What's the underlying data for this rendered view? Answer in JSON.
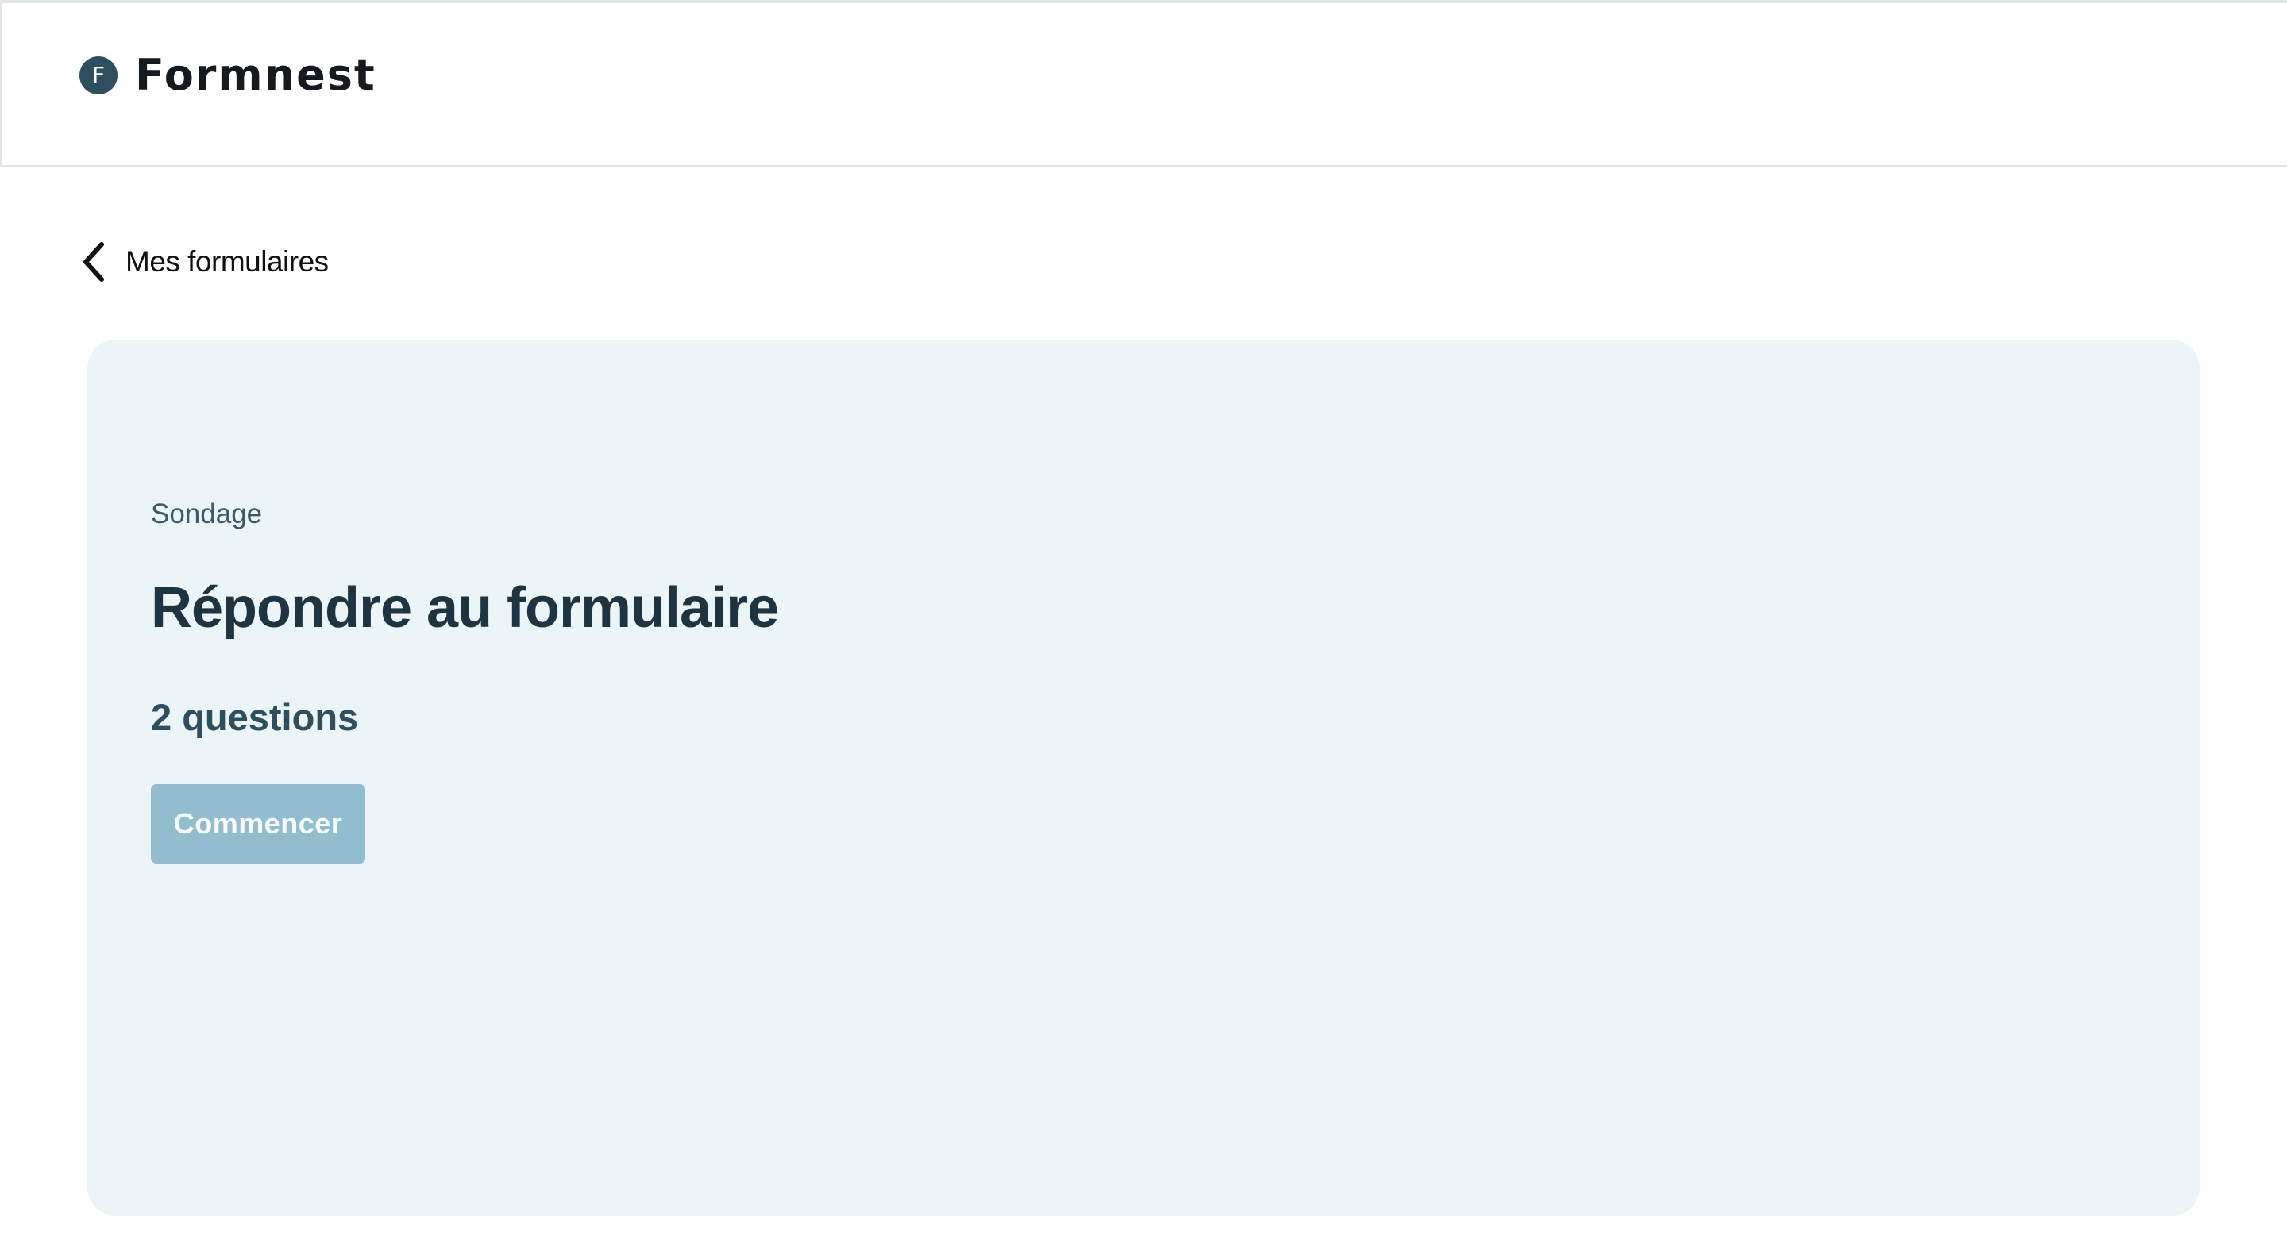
{
  "header": {
    "logo_letter": "F",
    "app_name": "Formnest"
  },
  "nav": {
    "back_label": "Mes formulaires",
    "back_icon": "chevron-left-icon"
  },
  "form_card": {
    "type_label": "Sondage",
    "title": "Répondre au formulaire",
    "question_count": "2 questions",
    "start_button_label": "Commencer"
  },
  "colors": {
    "brand": "#2f4e5e",
    "card_background": "#ebf4f7",
    "button_background": "#91bdce",
    "title_text": "#1e3440"
  }
}
